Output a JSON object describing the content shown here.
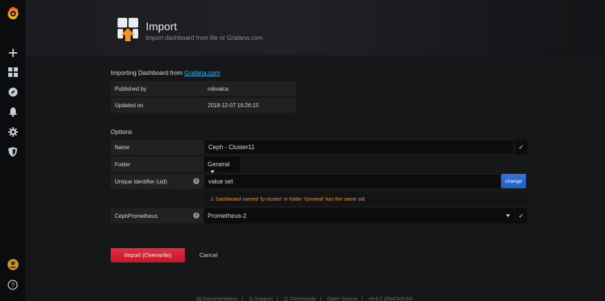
{
  "sidebar": {
    "icons": [
      "grafana-logo-icon",
      "plus-icon",
      "dashboards-icon",
      "explore-icon",
      "bell-icon",
      "gear-icon",
      "shield-icon",
      "user-avatar-icon",
      "help-icon"
    ]
  },
  "header": {
    "title": "Import",
    "subtitle": "Import dashboard from file or Grafana.com"
  },
  "importing": {
    "prefix": "Importing Dashboard from ",
    "link": "Grafana.com"
  },
  "info": [
    {
      "label": "Published by",
      "value": "robvalca"
    },
    {
      "label": "Updated on",
      "value": "2018-12-07 16:26:15"
    }
  ],
  "options": {
    "title": "Options",
    "name_label": "Name",
    "name_value": "Ceph - Cluster11",
    "folder_label": "Folder",
    "folder_value": "General",
    "uid_label": "Unique identifier (uid)",
    "uid_value": "value set",
    "change_label": "change",
    "warning": "Dashboard named 'lp-cluster' in folder 'General' has the same uid",
    "datasource_label": "CephPrometheus",
    "datasource_value": "Prometheus-2"
  },
  "actions": {
    "import_label": "Import (Overwrite)",
    "cancel_label": "Cancel"
  },
  "footer": {
    "documentation": "Documentation",
    "support": "Support",
    "community": "Community",
    "open_source": "Open Source",
    "version": "v6.6.2 (3fa63cfc34)"
  },
  "colors": {
    "brand": "#f05a28",
    "link": "#33b5e5",
    "success": "#7eb26d",
    "warning": "#f79520",
    "primary_button": "#3274d9",
    "danger_button": "#e02f44"
  }
}
